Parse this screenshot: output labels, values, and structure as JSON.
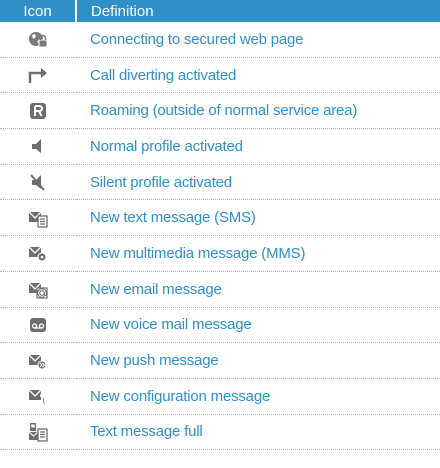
{
  "table": {
    "headers": {
      "icon": "Icon",
      "definition": "Definition"
    },
    "rows": [
      {
        "icon": "globe-lock-icon",
        "definition": "Connecting to secured web page"
      },
      {
        "icon": "call-divert-arrow-icon",
        "definition": "Call diverting activated"
      },
      {
        "icon": "roaming-r-icon",
        "definition": "Roaming (outside of normal service area)"
      },
      {
        "icon": "speaker-icon",
        "definition": "Normal profile activated"
      },
      {
        "icon": "speaker-muted-icon",
        "definition": "Silent profile activated"
      },
      {
        "icon": "envelope-text-icon",
        "definition": "New text message (SMS)"
      },
      {
        "icon": "envelope-multimedia-icon",
        "definition": "New multimedia message (MMS)"
      },
      {
        "icon": "envelope-email-icon",
        "definition": "New email message"
      },
      {
        "icon": "voicemail-icon",
        "definition": "New voice mail message"
      },
      {
        "icon": "envelope-push-icon",
        "definition": "New push message"
      },
      {
        "icon": "envelope-config-icon",
        "definition": "New configuration message"
      },
      {
        "icon": "message-full-icon",
        "definition": "Text message full"
      }
    ]
  },
  "colors": {
    "header_bg": "#2f8fc7",
    "text_blue": "#2f8fc7",
    "icon_gray": "#6e6e6e"
  }
}
